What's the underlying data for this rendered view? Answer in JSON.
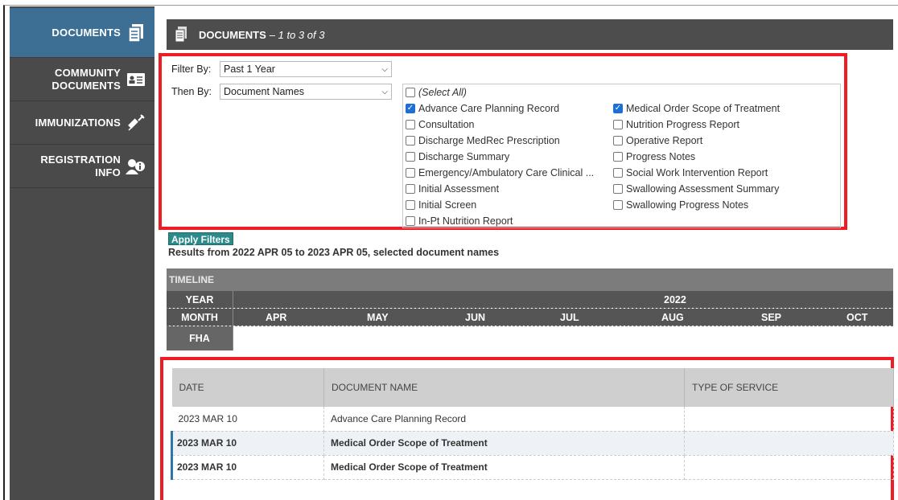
{
  "sidebar": {
    "items": [
      {
        "label": "DOCUMENTS",
        "icon": "documents-icon"
      },
      {
        "label": "COMMUNITY DOCUMENTS",
        "icon": "id-card-icon"
      },
      {
        "label": "IMMUNIZATIONS",
        "icon": "syringe-icon"
      },
      {
        "label": "REGISTRATION INFO",
        "icon": "user-info-icon"
      }
    ]
  },
  "header": {
    "title": "DOCUMENTS",
    "range": " – 1 to 3 of 3"
  },
  "filters": {
    "filter_by_label": "Filter By:",
    "filter_by_value": "Past 1 Year",
    "then_by_label": "Then By:",
    "then_by_value": "Document Names",
    "select_all": "(Select All)",
    "col1": [
      {
        "label": "Advance Care Planning Record",
        "checked": true
      },
      {
        "label": "Consultation",
        "checked": false
      },
      {
        "label": "Discharge MedRec Prescription",
        "checked": false
      },
      {
        "label": "Discharge Summary",
        "checked": false
      },
      {
        "label": "Emergency/Ambulatory Care Clinical ...",
        "checked": false
      },
      {
        "label": "Initial Assessment",
        "checked": false
      },
      {
        "label": "Initial Screen",
        "checked": false
      },
      {
        "label": "In-Pt Nutrition Report",
        "checked": false
      }
    ],
    "col2": [
      {
        "label": "Medical Order Scope of Treatment",
        "checked": true
      },
      {
        "label": "Nutrition Progress Report",
        "checked": false
      },
      {
        "label": "Operative Report",
        "checked": false
      },
      {
        "label": "Progress Notes",
        "checked": false
      },
      {
        "label": "Social Work Intervention Report",
        "checked": false
      },
      {
        "label": "Swallowing Assessment Summary",
        "checked": false
      },
      {
        "label": "Swallowing Progress Notes",
        "checked": false
      }
    ]
  },
  "apply_label": "Apply Filters",
  "results_text": "Results from 2022 APR 05 to 2023 APR 05, selected document names",
  "timeline": {
    "title": "TIMELINE",
    "year_label": "YEAR",
    "year_value": "2022",
    "month_label": "MONTH",
    "months": [
      "APR",
      "MAY",
      "JUN",
      "JUL",
      "AUG",
      "SEP",
      "OCT"
    ],
    "fha_label": "FHA"
  },
  "table": {
    "headers": [
      "DATE",
      "DOCUMENT NAME",
      "TYPE OF SERVICE"
    ],
    "rows": [
      {
        "date": "2023 MAR 10",
        "name": "Advance Care Planning Record",
        "service": ""
      },
      {
        "date": "2023 MAR 10",
        "name": "Medical Order Scope of Treatment",
        "service": ""
      },
      {
        "date": "2023 MAR 10",
        "name": "Medical Order Scope of Treatment",
        "service": ""
      }
    ]
  },
  "colors": {
    "sidebar": "#4a4a4a",
    "active": "#3d6f95",
    "highlight": "#ee1c24",
    "apply": "#2b8a8a",
    "check": "#1d6fd6"
  }
}
